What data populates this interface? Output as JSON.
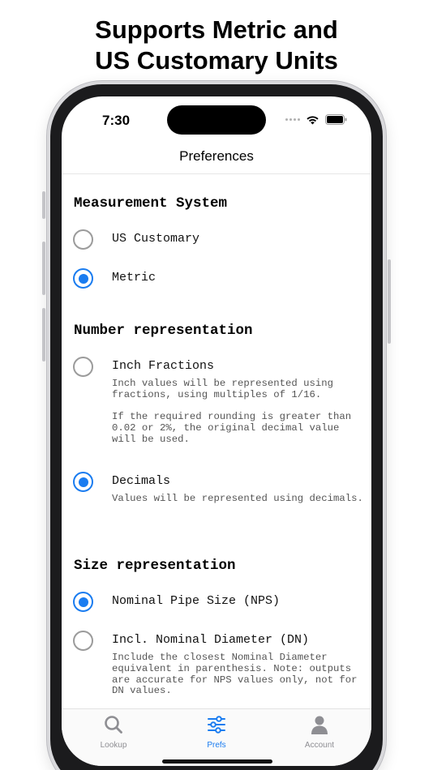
{
  "headline": {
    "line1": "Supports Metric and",
    "line2": "US Customary Units"
  },
  "status_bar": {
    "time": "7:30",
    "signal_icon": "signal-dots-icon",
    "wifi_icon": "wifi-icon",
    "battery_icon": "battery-icon"
  },
  "nav": {
    "title": "Preferences"
  },
  "sections": {
    "measurement": {
      "title": "Measurement System",
      "options": [
        {
          "label": "US Customary",
          "selected": false
        },
        {
          "label": "Metric",
          "selected": true
        }
      ]
    },
    "number": {
      "title": "Number representation",
      "options": [
        {
          "label": "Inch Fractions",
          "selected": false,
          "desc1": "Inch values will be represented using fractions, using multiples of 1/16.",
          "desc2": "If the required rounding is greater than 0.02 or 2%, the original decimal value will be used."
        },
        {
          "label": "Decimals",
          "selected": true,
          "desc1": "Values will be represented using decimals."
        }
      ]
    },
    "size": {
      "title": "Size representation",
      "options": [
        {
          "label": "Nominal Pipe Size (NPS)",
          "selected": true
        },
        {
          "label": "Incl. Nominal Diameter (DN)",
          "selected": false,
          "desc1": "Include the closest Nominal Diameter equivalent in parenthesis. Note: outputs are accurate for NPS values only, not for DN values."
        }
      ]
    }
  },
  "tabbar": {
    "tabs": [
      {
        "label": "Lookup",
        "icon": "search-icon",
        "active": false
      },
      {
        "label": "Prefs",
        "icon": "sliders-icon",
        "active": true
      },
      {
        "label": "Account",
        "icon": "person-icon",
        "active": false
      }
    ]
  },
  "colors": {
    "accent": "#1a7cf0",
    "inactive": "#8e8e93",
    "radio_off": "#9b9b9b"
  }
}
